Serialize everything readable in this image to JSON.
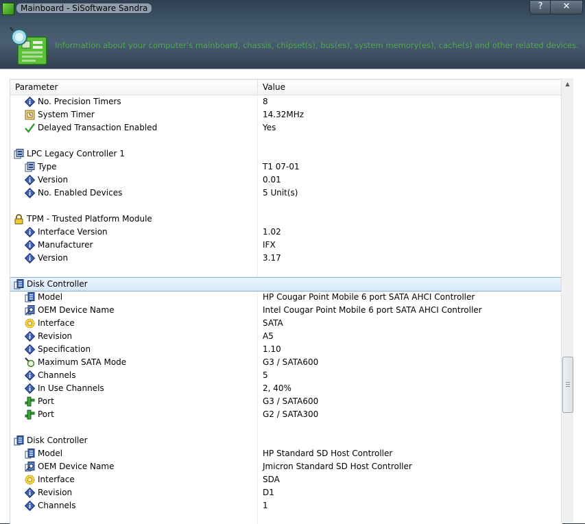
{
  "window": {
    "title": "Mainboard - SiSoftware Sandra",
    "help_btn": "?",
    "close_btn": "✕",
    "description": "Information about your computer's mainboard, chassis, chipset(s), bus(es), system memory(es), cache(s) and other related devices."
  },
  "table": {
    "col_param": "Parameter",
    "col_value": "Value",
    "rows": [
      {
        "level": 1,
        "icon": "diamond-info-icon",
        "name": "No. Precision Timers",
        "value": "8"
      },
      {
        "level": 1,
        "icon": "timer-chip-icon",
        "name": "System Timer",
        "value": "14.32MHz"
      },
      {
        "level": 1,
        "icon": "checkmark-icon",
        "name": "Delayed Transaction Enabled",
        "value": "Yes"
      },
      {
        "level": -1,
        "name": "",
        "value": ""
      },
      {
        "level": 0,
        "icon": "controller-icon",
        "name": "LPC Legacy Controller 1",
        "value": ""
      },
      {
        "level": 1,
        "icon": "controller-icon",
        "name": "Type",
        "value": "T1 07-01"
      },
      {
        "level": 1,
        "icon": "diamond-info-icon",
        "name": "Version",
        "value": "0.01"
      },
      {
        "level": 1,
        "icon": "diamond-info-icon",
        "name": "No. Enabled Devices",
        "value": "5 Unit(s)"
      },
      {
        "level": -1,
        "name": "",
        "value": ""
      },
      {
        "level": 0,
        "icon": "padlock-icon",
        "name": "TPM - Trusted Platform Module",
        "value": ""
      },
      {
        "level": 1,
        "icon": "diamond-info-icon",
        "name": "Interface Version",
        "value": "1.02"
      },
      {
        "level": 1,
        "icon": "diamond-info-icon",
        "name": "Manufacturer",
        "value": "IFX"
      },
      {
        "level": 1,
        "icon": "diamond-info-icon",
        "name": "Version",
        "value": "3.17"
      },
      {
        "level": -1,
        "name": "",
        "value": ""
      },
      {
        "level": 0,
        "icon": "disk-controller-icon",
        "name": "Disk Controller",
        "value": "",
        "selected": true
      },
      {
        "level": 1,
        "icon": "disk-controller-icon",
        "name": "Model",
        "value": "HP Cougar Point Mobile 6 port SATA AHCI Controller"
      },
      {
        "level": 1,
        "icon": "oem-device-icon",
        "name": "OEM Device Name",
        "value": "Intel Cougar Point Mobile 6 port SATA AHCI Controller"
      },
      {
        "level": 1,
        "icon": "interface-gear-icon",
        "name": "Interface",
        "value": "SATA"
      },
      {
        "level": 1,
        "icon": "diamond-info-icon",
        "name": "Revision",
        "value": "A5"
      },
      {
        "level": 1,
        "icon": "diamond-info-icon",
        "name": "Specification",
        "value": "1.10"
      },
      {
        "level": 1,
        "icon": "magnifier-icon",
        "name": "Maximum SATA Mode",
        "value": "G3 / SATA600"
      },
      {
        "level": 1,
        "icon": "diamond-info-icon",
        "name": "Channels",
        "value": "5"
      },
      {
        "level": 1,
        "icon": "diamond-info-icon",
        "name": "In Use Channels",
        "value": "2, 40%"
      },
      {
        "level": 1,
        "icon": "port-plug-icon",
        "name": "Port",
        "value": "G3 / SATA600"
      },
      {
        "level": 1,
        "icon": "port-plug-icon",
        "name": "Port",
        "value": "G2 / SATA300"
      },
      {
        "level": -1,
        "name": "",
        "value": ""
      },
      {
        "level": 0,
        "icon": "disk-controller-icon",
        "name": "Disk Controller",
        "value": ""
      },
      {
        "level": 1,
        "icon": "disk-controller-icon",
        "name": "Model",
        "value": "HP Standard SD Host Controller"
      },
      {
        "level": 1,
        "icon": "oem-device-icon",
        "name": "OEM Device Name",
        "value": "Jmicron Standard SD Host Controller"
      },
      {
        "level": 1,
        "icon": "interface-gear-icon",
        "name": "Interface",
        "value": "SDA"
      },
      {
        "level": 1,
        "icon": "diamond-info-icon",
        "name": "Revision",
        "value": "D1"
      },
      {
        "level": 1,
        "icon": "diamond-info-icon",
        "name": "Channels",
        "value": "1"
      }
    ]
  },
  "scrollbar": {
    "up_arrow": "▲"
  }
}
